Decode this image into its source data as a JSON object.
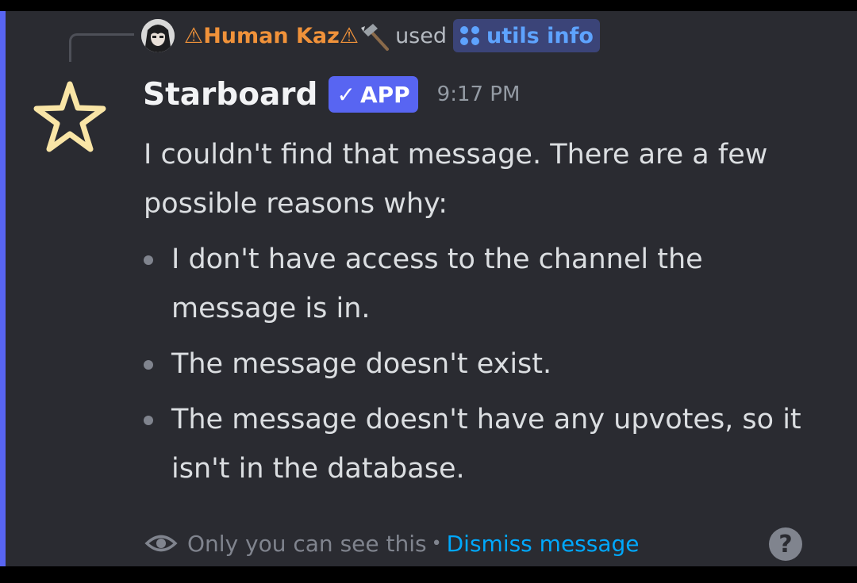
{
  "reply": {
    "username": "⚠Human Kaz⚠",
    "username_color": "#f0923a",
    "hammer_icon": "hammer-icon",
    "used_text": "used",
    "command_icon": "app-command-icon",
    "command_name": "utils info"
  },
  "message": {
    "author": "Starboard",
    "avatar_icon": "star-icon",
    "badge": {
      "check": "✓",
      "label": "APP",
      "color": "#5865f2"
    },
    "timestamp": "9:17 PM",
    "intro": "I couldn't find that message. There are a few possible reasons why:",
    "reasons": [
      "I don't have access to the channel the message is in.",
      "The message doesn't exist.",
      "The message doesn't have any upvotes, so it isn't in the database."
    ]
  },
  "footer": {
    "visibility_icon": "eye-icon",
    "only_you_text": "Only you can see this",
    "separator": "•",
    "dismiss_label": "Dismiss message",
    "help_label": "?"
  },
  "colors": {
    "background": "#2a2b31",
    "accent_bar": "#5865f2",
    "link": "#00a8fc"
  }
}
